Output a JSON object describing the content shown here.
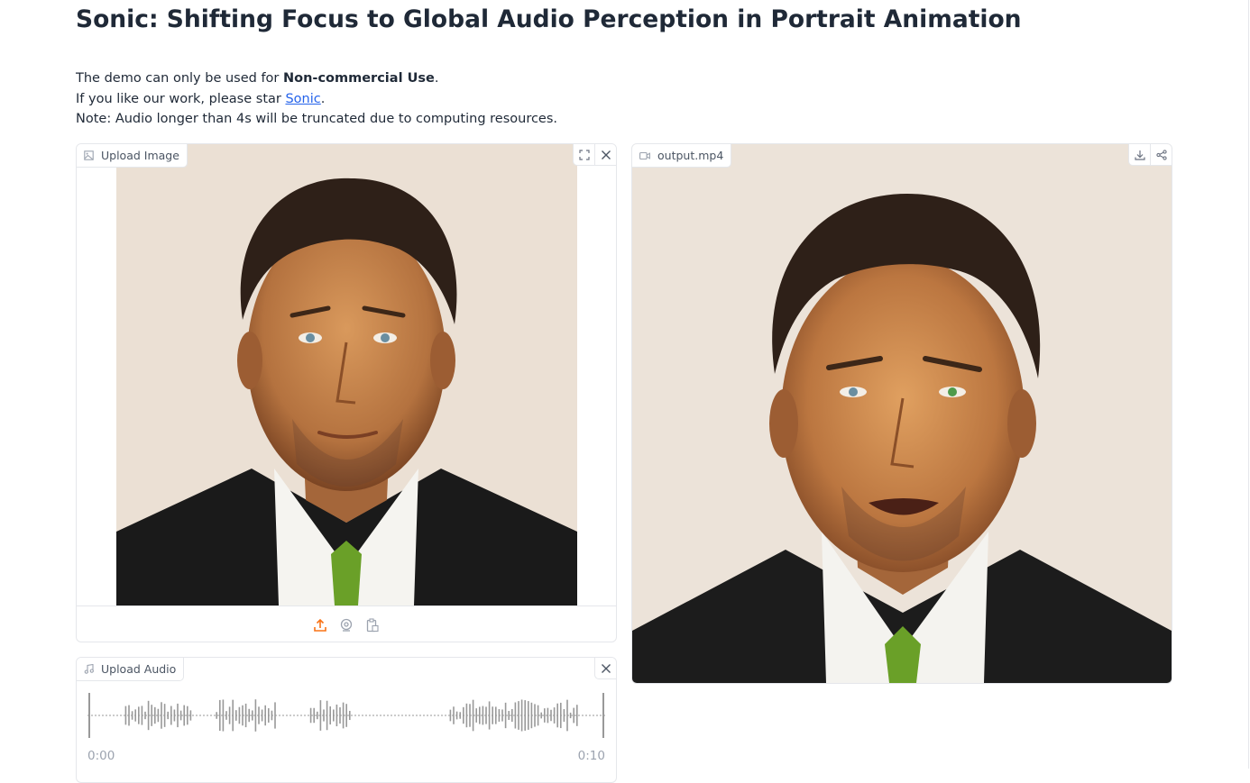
{
  "page": {
    "title": "Sonic: Shifting Focus to Global Audio Perception in Portrait Animation",
    "line1_pre": "The demo can only be used for ",
    "line1_bold": "Non-commercial Use",
    "line1_post": ".",
    "line2_pre": "If you like our work, please star ",
    "line2_link": "Sonic",
    "line2_post": ".",
    "line3": "Note: Audio longer than 4s will be truncated due to computing resources."
  },
  "image_input": {
    "label": "Upload Image",
    "label_icon": "image-icon",
    "controls": [
      "fullscreen-icon",
      "close-icon"
    ],
    "sources": [
      "upload-icon",
      "webcam-icon",
      "clipboard-icon"
    ],
    "active_source": "upload"
  },
  "audio_input": {
    "label": "Upload Audio",
    "label_icon": "music-note-icon",
    "controls": [
      "close-icon"
    ],
    "time_start": "0:00",
    "time_end": "0:10"
  },
  "video_output": {
    "label": "output.mp4",
    "label_icon": "video-icon",
    "controls": [
      "download-icon",
      "share-icon"
    ]
  },
  "colors": {
    "text": "#1f2937",
    "muted": "#9ca3af",
    "border": "#e5e7eb",
    "accent": "#f97316",
    "link": "#2563eb",
    "waveform": "#999999"
  }
}
